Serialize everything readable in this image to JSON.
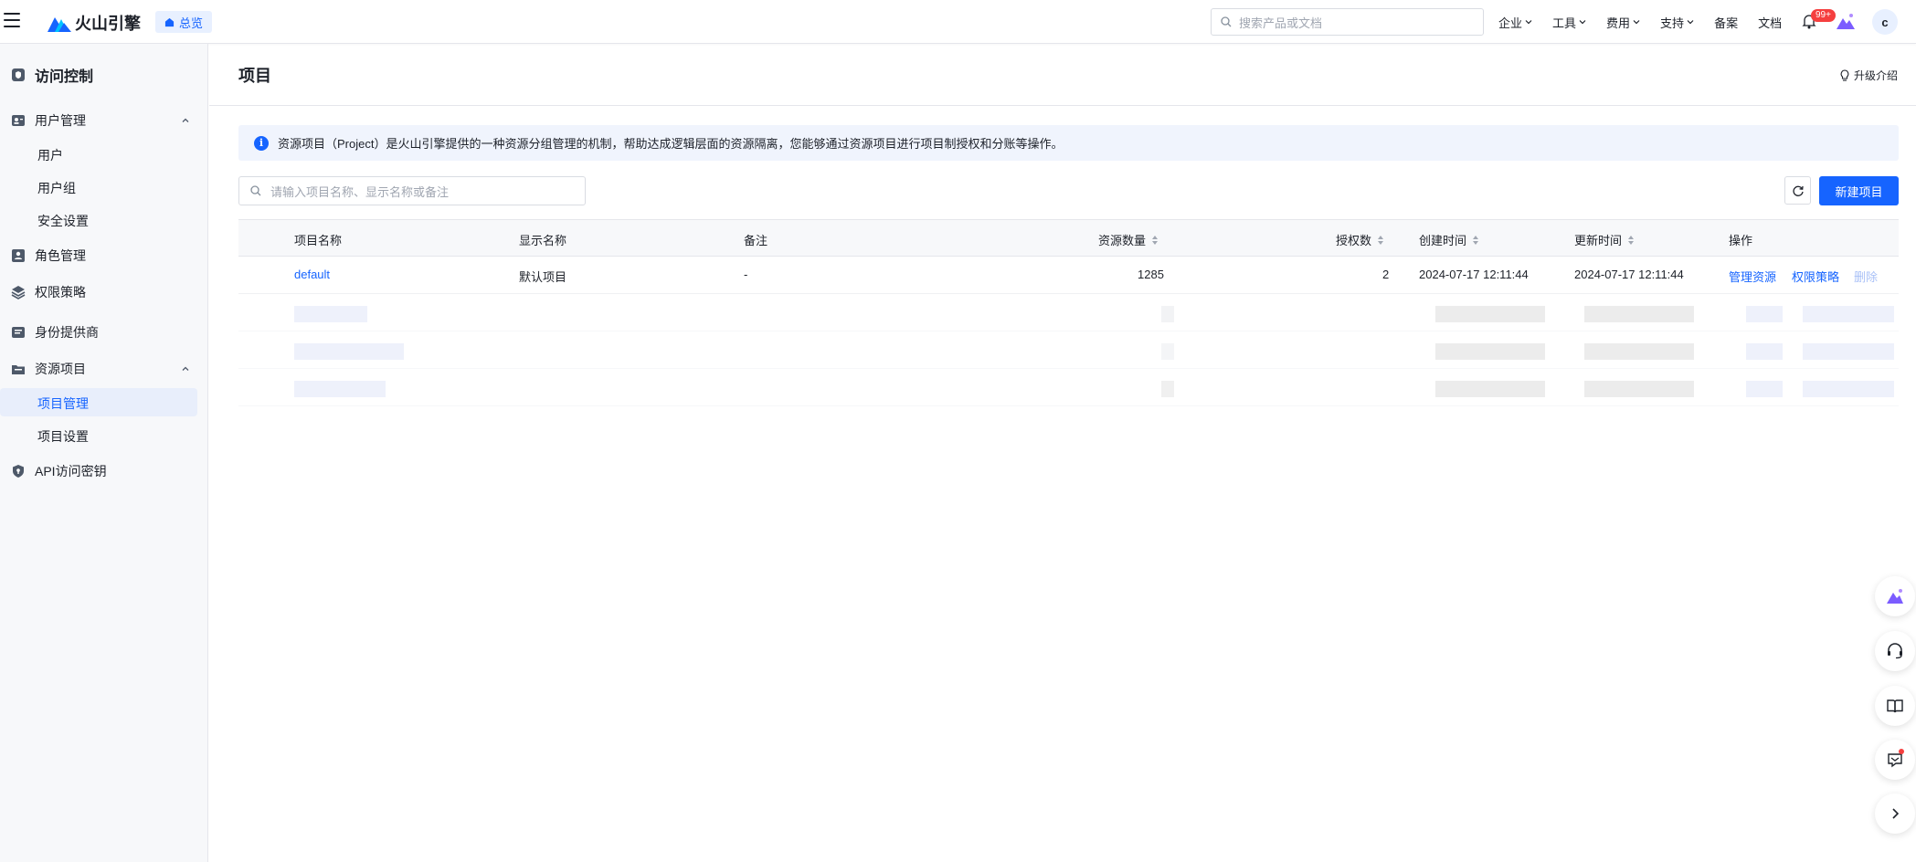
{
  "topbar": {
    "brand": "火山引擎",
    "overview": "总览",
    "search_placeholder": "搜索产品或文档",
    "nav": {
      "enterprise": "企业",
      "tools": "工具",
      "billing": "费用",
      "support": "支持",
      "filing": "备案",
      "docs": "文档"
    },
    "notify_badge": "99+",
    "avatar": "c"
  },
  "sidebar": {
    "title": "访问控制",
    "user_mgmt": "用户管理",
    "users": "用户",
    "user_groups": "用户组",
    "security": "安全设置",
    "roles": "角色管理",
    "policies": "权限策略",
    "idp": "身份提供商",
    "resource_projects": "资源项目",
    "project_mgmt": "项目管理",
    "project_settings": "项目设置",
    "api_keys": "API访问密钥"
  },
  "page": {
    "title": "项目",
    "upgrade": "升级介绍",
    "info": "资源项目（Project）是火山引擎提供的一种资源分组管理的机制，帮助达成逻辑层面的资源隔离，您能够通过资源项目进行项目制授权和分账等操作。",
    "search_placeholder": "请输入项目名称、显示名称或备注",
    "new_button": "新建项目"
  },
  "table": {
    "headers": {
      "name": "项目名称",
      "display": "显示名称",
      "remark": "备注",
      "resources": "资源数量",
      "grants": "授权数",
      "created": "创建时间",
      "updated": "更新时间",
      "actions": "操作"
    },
    "rows": [
      {
        "name": "default",
        "display": "默认项目",
        "remark": "-",
        "resources": "1285",
        "grants": "2",
        "created": "2024-07-17 12:11:44",
        "updated": "2024-07-17 12:11:44",
        "action_manage": "管理资源",
        "action_policy": "权限策略",
        "action_delete": "删除"
      }
    ]
  },
  "colors": {
    "primary": "#1664ff",
    "sidebar_bg": "#f7f8fa",
    "active_bg": "#e8eefb",
    "danger": "#f53f3f"
  }
}
